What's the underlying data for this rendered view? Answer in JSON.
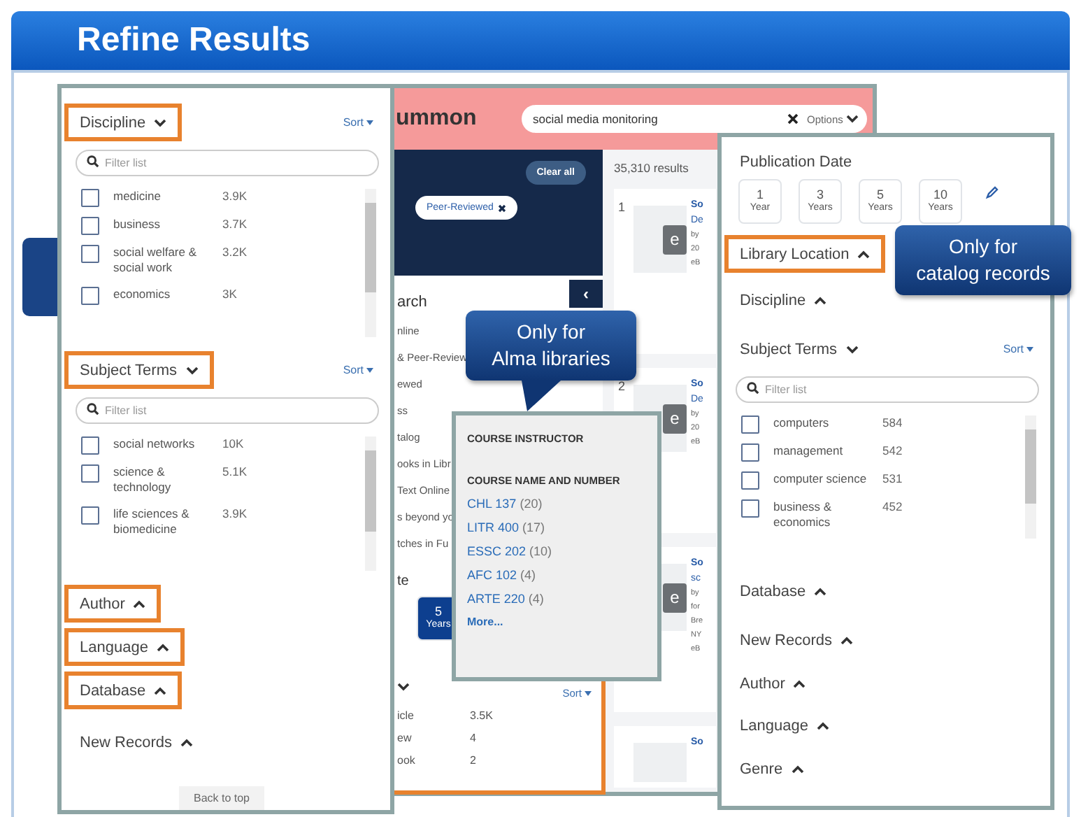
{
  "title": "Refine Results",
  "summon": {
    "logo": "ummon",
    "search": {
      "value": "social media monitoring"
    },
    "options": "Options",
    "clear_all": "Clear all",
    "collapse_label": "‹",
    "chips": [
      {
        "label": "Peer-Reviewed"
      }
    ],
    "fragments": [
      {
        "text": "arch",
        "kind": "heading"
      },
      {
        "text": "nline",
        "kind": "link"
      },
      {
        "text": "& Peer-Review",
        "kind": "link"
      },
      {
        "text": "ewed",
        "kind": "link"
      },
      {
        "text": "ss",
        "kind": "link"
      },
      {
        "text": "talog",
        "kind": "link"
      },
      {
        "text": "ooks in Libr",
        "kind": "link"
      },
      {
        "text": "Text Online",
        "kind": "link"
      },
      {
        "text": "s beyond yo",
        "kind": "link"
      },
      {
        "text": "tches in Fu",
        "kind": "link"
      }
    ],
    "date_heading": "te",
    "date_options": [
      {
        "number": "5",
        "unit": "Years",
        "selected": true
      }
    ],
    "type_sort": "Sort",
    "type_rows": [
      {
        "label": "icle",
        "count": "3.5K"
      },
      {
        "label": "ew",
        "count": "4"
      },
      {
        "label": "ook",
        "count": "2"
      }
    ],
    "results_count": "35,310 results",
    "results": [
      {
        "number": "1",
        "icon_text": "e",
        "lines": [
          "So",
          "De",
          "by",
          "20",
          "eB"
        ]
      },
      {
        "number": "2",
        "icon_text": "e",
        "lines": [
          "So",
          "De",
          "by",
          "20",
          "eB"
        ]
      },
      {
        "icon_text": "e",
        "lines": [
          "So",
          "sc",
          "by",
          "for",
          "Bre",
          "NY",
          "eB"
        ]
      },
      {
        "lines": [
          "So"
        ]
      }
    ]
  },
  "left_panel": {
    "sections": [
      {
        "kind": "facet",
        "label": "Discipline",
        "expanded": true,
        "highlighted": true,
        "sort": "Sort",
        "filter_placeholder": "Filter list",
        "items": [
          {
            "label": "medicine",
            "count": "3.9K",
            "checked": false
          },
          {
            "label": "business",
            "count": "3.7K",
            "checked": false
          },
          {
            "label": "social welfare & social work",
            "count": "3.2K",
            "checked": false
          },
          {
            "label": "economics",
            "count": "3K",
            "checked": false
          }
        ]
      },
      {
        "kind": "facet",
        "label": "Subject Terms",
        "expanded": true,
        "highlighted": true,
        "sort": "Sort",
        "filter_placeholder": "Filter list",
        "items": [
          {
            "label": "social networks",
            "count": "10K",
            "checked": false
          },
          {
            "label": "science & technology",
            "count": "5.1K",
            "checked": false
          },
          {
            "label": "life sciences & biomedicine",
            "count": "3.9K",
            "checked": false
          }
        ]
      },
      {
        "kind": "facet",
        "label": "Author",
        "expanded": false,
        "highlighted": true
      },
      {
        "kind": "facet",
        "label": "Language",
        "expanded": false,
        "highlighted": true
      },
      {
        "kind": "facet",
        "label": "Database",
        "expanded": false,
        "highlighted": true
      },
      {
        "kind": "facet",
        "label": "New Records",
        "expanded": false,
        "highlighted": false
      }
    ],
    "back_to_top": "Back to top"
  },
  "popup": {
    "heading": "COURSE INSTRUCTOR",
    "subheading": "COURSE NAME AND NUMBER",
    "courses": [
      {
        "name": "CHL 137",
        "count": "(20)"
      },
      {
        "name": "LITR 400",
        "count": "(17)"
      },
      {
        "name": "ESSC 202",
        "count": "(10)"
      },
      {
        "name": "AFC 102",
        "count": "(4)"
      },
      {
        "name": "ARTE 220",
        "count": "(4)"
      }
    ],
    "more": "More..."
  },
  "right_panel": {
    "sections": [
      {
        "kind": "date",
        "label": "Publication Date",
        "options": [
          {
            "number": "1",
            "unit": "Year",
            "selected": false
          },
          {
            "number": "3",
            "unit": "Years",
            "selected": false
          },
          {
            "number": "5",
            "unit": "Years",
            "selected": false
          },
          {
            "number": "10",
            "unit": "Years",
            "selected": false
          }
        ]
      },
      {
        "kind": "facet",
        "label": "Library Location",
        "expanded": false,
        "highlighted": true
      },
      {
        "kind": "facet",
        "label": "Discipline",
        "expanded": false,
        "highlighted": false
      },
      {
        "kind": "facet",
        "label": "Subject Terms",
        "expanded": true,
        "highlighted": false,
        "sort": "Sort",
        "filter_placeholder": "Filter list",
        "items": [
          {
            "label": "computers",
            "count": "584",
            "checked": false
          },
          {
            "label": "management",
            "count": "542",
            "checked": false
          },
          {
            "label": "computer science",
            "count": "531",
            "checked": false
          },
          {
            "label": "business & economics",
            "count": "452",
            "checked": false
          }
        ]
      },
      {
        "kind": "facet",
        "label": "Database",
        "expanded": false,
        "highlighted": false
      },
      {
        "kind": "facet",
        "label": "New Records",
        "expanded": false,
        "highlighted": false
      },
      {
        "kind": "facet",
        "label": "Author",
        "expanded": false,
        "highlighted": false
      },
      {
        "kind": "facet",
        "label": "Language",
        "expanded": false,
        "highlighted": false
      },
      {
        "kind": "facet",
        "label": "Genre",
        "expanded": false,
        "highlighted": false
      }
    ]
  },
  "callouts": [
    {
      "kind": "pointer",
      "lines": [
        "Only for",
        "Alma libraries"
      ]
    },
    {
      "kind": "plain",
      "lines": [
        "Only for",
        "catalog records"
      ]
    }
  ]
}
